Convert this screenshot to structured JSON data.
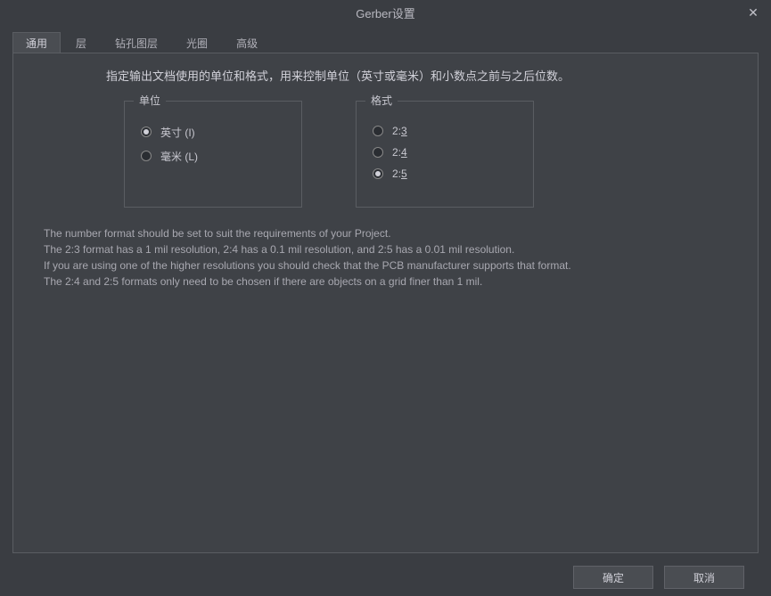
{
  "title": "Gerber设置",
  "tabs": [
    "通用",
    "层",
    "钻孔图层",
    "光圈",
    "高级"
  ],
  "instruction": "指定输出文档使用的单位和格式，用来控制单位（英寸或毫米）和小数点之前与之后位数。",
  "units": {
    "title": "单位",
    "options": [
      {
        "label": "英寸 (I)",
        "selected": true
      },
      {
        "label": "毫米 (L)",
        "selected": false
      }
    ]
  },
  "format": {
    "title": "格式",
    "options": [
      {
        "label": "2:3",
        "selected": false
      },
      {
        "label": "2:4",
        "selected": false
      },
      {
        "label": "2:5",
        "selected": true
      }
    ]
  },
  "info_lines": [
    "The number format should be set to suit the requirements of your Project.",
    "The 2:3 format has a 1 mil resolution, 2:4 has a 0.1 mil resolution, and 2:5 has a 0.01 mil resolution.",
    "If you are using one of the higher resolutions you should check that the PCB manufacturer supports that format.",
    "The 2:4 and 2:5 formats only need to be chosen if there are objects on a grid finer than 1 mil."
  ],
  "buttons": {
    "ok": "确定",
    "cancel": "取消"
  }
}
